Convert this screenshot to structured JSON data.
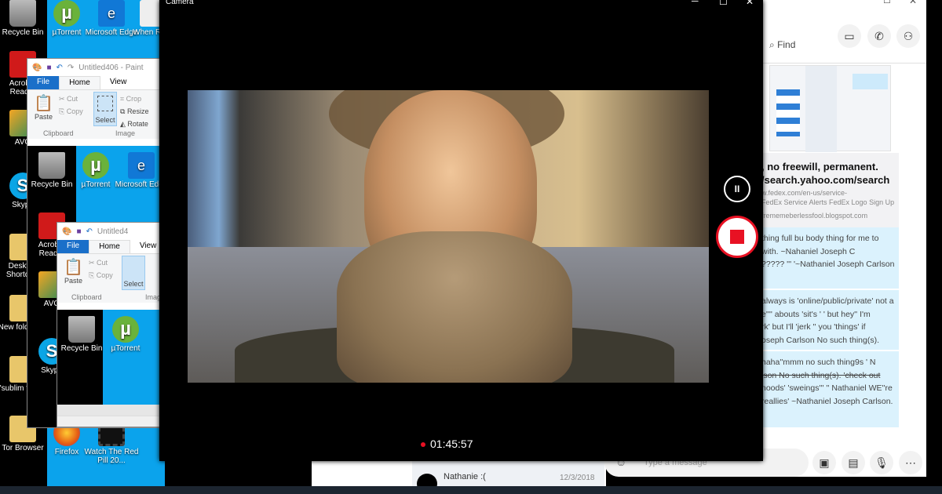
{
  "desktop": {
    "icons_left": [
      "Recycle Bin",
      "Acrobat Reader",
      "AVG",
      "Skype",
      "Desktop Shortcuts",
      "New folder (3)",
      "'sublim folder",
      "Tor Browser"
    ],
    "icons_blue": [
      "µTorrent",
      "Microsoft Edge",
      "When Reali",
      "Firefox",
      "Watch The Red Pill 20..."
    ]
  },
  "paint_back": {
    "title": "Untitled406 - Paint",
    "tabs": [
      "File",
      "Home",
      "View"
    ],
    "clipboard": {
      "paste": "Paste",
      "cut": "Cut",
      "copy": "Copy",
      "group": "Clipboard"
    },
    "image": {
      "select": "Select",
      "crop": "Crop",
      "resize": "Resize",
      "rotate": "Rotate",
      "group": "Image"
    },
    "canvas_icons": [
      "Recycle Bin",
      "µTorrent",
      "Microsoft Edge",
      "Acrobat Reader",
      "AVG",
      "Skype"
    ]
  },
  "paint_front": {
    "title": "Untitled4",
    "tabs": [
      "File",
      "Home",
      "View"
    ],
    "clipboard": {
      "paste": "Paste",
      "cut": "Cut",
      "copy": "Copy",
      "group": "Clipboard"
    },
    "image": {
      "select": "Select",
      "group": "Image"
    },
    "canvas_icons": [
      "Recycle Bin",
      "µTorrent"
    ]
  },
  "camera": {
    "title": "Camera",
    "timer": "01:45:57",
    "recording_color": "#e81123",
    "controls": {
      "minimize": "─",
      "maximize": "☐",
      "close": "✕"
    }
  },
  "skype": {
    "find": "Find",
    "link_card": {
      "title_line1": ", no freewill, permanent.",
      "title_line2": "/search.yahoo.com/search",
      "url1": "w.fedex.com/en-us/service-",
      "url2": "FedEx Service Alerts FedEx Logo Sign Up",
      "domain": "frememeberlessfool.blogspot.com"
    },
    "messages": [
      [
        "thing full bu body thing for me to",
        "with. ~Nahaniel Joseph C",
        "????? '''  '~Nathaniel Joseph Carlson"
      ],
      [
        "always is 'online/public/private' not a",
        "e''''  abouts 'sit's ' ' but hey'' I'm",
        "rk' but I'll 'jerk '' you 'things'  if",
        "oseph Carlson No such thing(s)."
      ],
      [
        "haha''mmm no such thing9s ' N",
        "lson No such thing(s). 'check out",
        "noods' 'sweings''' '' Nathaniel WE''re",
        "reallies' ~Nathaniel Joseph Carlson."
      ]
    ],
    "message_placeholder": "Type a message",
    "contact": {
      "name": "Nathanie :(",
      "date": "12/3/2018"
    },
    "accent": "#dbf2fd"
  }
}
